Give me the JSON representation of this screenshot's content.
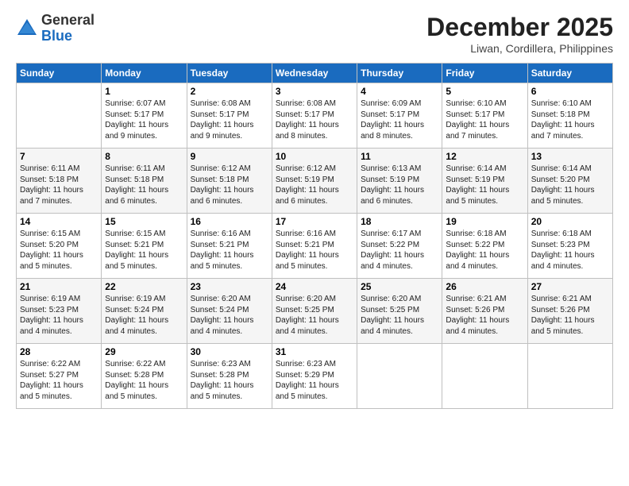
{
  "header": {
    "logo": {
      "general": "General",
      "blue": "Blue"
    },
    "title": "December 2025",
    "location": "Liwan, Cordillera, Philippines"
  },
  "weekdays": [
    "Sunday",
    "Monday",
    "Tuesday",
    "Wednesday",
    "Thursday",
    "Friday",
    "Saturday"
  ],
  "weeks": [
    [
      {
        "day": "",
        "sunrise": "",
        "sunset": "",
        "daylight": ""
      },
      {
        "day": "1",
        "sunrise": "Sunrise: 6:07 AM",
        "sunset": "Sunset: 5:17 PM",
        "daylight": "Daylight: 11 hours and 9 minutes."
      },
      {
        "day": "2",
        "sunrise": "Sunrise: 6:08 AM",
        "sunset": "Sunset: 5:17 PM",
        "daylight": "Daylight: 11 hours and 9 minutes."
      },
      {
        "day": "3",
        "sunrise": "Sunrise: 6:08 AM",
        "sunset": "Sunset: 5:17 PM",
        "daylight": "Daylight: 11 hours and 8 minutes."
      },
      {
        "day": "4",
        "sunrise": "Sunrise: 6:09 AM",
        "sunset": "Sunset: 5:17 PM",
        "daylight": "Daylight: 11 hours and 8 minutes."
      },
      {
        "day": "5",
        "sunrise": "Sunrise: 6:10 AM",
        "sunset": "Sunset: 5:17 PM",
        "daylight": "Daylight: 11 hours and 7 minutes."
      },
      {
        "day": "6",
        "sunrise": "Sunrise: 6:10 AM",
        "sunset": "Sunset: 5:18 PM",
        "daylight": "Daylight: 11 hours and 7 minutes."
      }
    ],
    [
      {
        "day": "7",
        "sunrise": "Sunrise: 6:11 AM",
        "sunset": "Sunset: 5:18 PM",
        "daylight": "Daylight: 11 hours and 7 minutes."
      },
      {
        "day": "8",
        "sunrise": "Sunrise: 6:11 AM",
        "sunset": "Sunset: 5:18 PM",
        "daylight": "Daylight: 11 hours and 6 minutes."
      },
      {
        "day": "9",
        "sunrise": "Sunrise: 6:12 AM",
        "sunset": "Sunset: 5:18 PM",
        "daylight": "Daylight: 11 hours and 6 minutes."
      },
      {
        "day": "10",
        "sunrise": "Sunrise: 6:12 AM",
        "sunset": "Sunset: 5:19 PM",
        "daylight": "Daylight: 11 hours and 6 minutes."
      },
      {
        "day": "11",
        "sunrise": "Sunrise: 6:13 AM",
        "sunset": "Sunset: 5:19 PM",
        "daylight": "Daylight: 11 hours and 6 minutes."
      },
      {
        "day": "12",
        "sunrise": "Sunrise: 6:14 AM",
        "sunset": "Sunset: 5:19 PM",
        "daylight": "Daylight: 11 hours and 5 minutes."
      },
      {
        "day": "13",
        "sunrise": "Sunrise: 6:14 AM",
        "sunset": "Sunset: 5:20 PM",
        "daylight": "Daylight: 11 hours and 5 minutes."
      }
    ],
    [
      {
        "day": "14",
        "sunrise": "Sunrise: 6:15 AM",
        "sunset": "Sunset: 5:20 PM",
        "daylight": "Daylight: 11 hours and 5 minutes."
      },
      {
        "day": "15",
        "sunrise": "Sunrise: 6:15 AM",
        "sunset": "Sunset: 5:21 PM",
        "daylight": "Daylight: 11 hours and 5 minutes."
      },
      {
        "day": "16",
        "sunrise": "Sunrise: 6:16 AM",
        "sunset": "Sunset: 5:21 PM",
        "daylight": "Daylight: 11 hours and 5 minutes."
      },
      {
        "day": "17",
        "sunrise": "Sunrise: 6:16 AM",
        "sunset": "Sunset: 5:21 PM",
        "daylight": "Daylight: 11 hours and 5 minutes."
      },
      {
        "day": "18",
        "sunrise": "Sunrise: 6:17 AM",
        "sunset": "Sunset: 5:22 PM",
        "daylight": "Daylight: 11 hours and 4 minutes."
      },
      {
        "day": "19",
        "sunrise": "Sunrise: 6:18 AM",
        "sunset": "Sunset: 5:22 PM",
        "daylight": "Daylight: 11 hours and 4 minutes."
      },
      {
        "day": "20",
        "sunrise": "Sunrise: 6:18 AM",
        "sunset": "Sunset: 5:23 PM",
        "daylight": "Daylight: 11 hours and 4 minutes."
      }
    ],
    [
      {
        "day": "21",
        "sunrise": "Sunrise: 6:19 AM",
        "sunset": "Sunset: 5:23 PM",
        "daylight": "Daylight: 11 hours and 4 minutes."
      },
      {
        "day": "22",
        "sunrise": "Sunrise: 6:19 AM",
        "sunset": "Sunset: 5:24 PM",
        "daylight": "Daylight: 11 hours and 4 minutes."
      },
      {
        "day": "23",
        "sunrise": "Sunrise: 6:20 AM",
        "sunset": "Sunset: 5:24 PM",
        "daylight": "Daylight: 11 hours and 4 minutes."
      },
      {
        "day": "24",
        "sunrise": "Sunrise: 6:20 AM",
        "sunset": "Sunset: 5:25 PM",
        "daylight": "Daylight: 11 hours and 4 minutes."
      },
      {
        "day": "25",
        "sunrise": "Sunrise: 6:20 AM",
        "sunset": "Sunset: 5:25 PM",
        "daylight": "Daylight: 11 hours and 4 minutes."
      },
      {
        "day": "26",
        "sunrise": "Sunrise: 6:21 AM",
        "sunset": "Sunset: 5:26 PM",
        "daylight": "Daylight: 11 hours and 4 minutes."
      },
      {
        "day": "27",
        "sunrise": "Sunrise: 6:21 AM",
        "sunset": "Sunset: 5:26 PM",
        "daylight": "Daylight: 11 hours and 5 minutes."
      }
    ],
    [
      {
        "day": "28",
        "sunrise": "Sunrise: 6:22 AM",
        "sunset": "Sunset: 5:27 PM",
        "daylight": "Daylight: 11 hours and 5 minutes."
      },
      {
        "day": "29",
        "sunrise": "Sunrise: 6:22 AM",
        "sunset": "Sunset: 5:28 PM",
        "daylight": "Daylight: 11 hours and 5 minutes."
      },
      {
        "day": "30",
        "sunrise": "Sunrise: 6:23 AM",
        "sunset": "Sunset: 5:28 PM",
        "daylight": "Daylight: 11 hours and 5 minutes."
      },
      {
        "day": "31",
        "sunrise": "Sunrise: 6:23 AM",
        "sunset": "Sunset: 5:29 PM",
        "daylight": "Daylight: 11 hours and 5 minutes."
      },
      {
        "day": "",
        "sunrise": "",
        "sunset": "",
        "daylight": ""
      },
      {
        "day": "",
        "sunrise": "",
        "sunset": "",
        "daylight": ""
      },
      {
        "day": "",
        "sunrise": "",
        "sunset": "",
        "daylight": ""
      }
    ]
  ]
}
